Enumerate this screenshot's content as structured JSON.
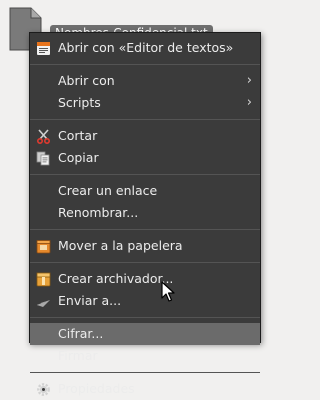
{
  "desktop": {
    "file_name": "Nombres-Confidencial.txt",
    "file_icon": "text-file-icon"
  },
  "menu": {
    "open_with_editor": "Abrir con «Editor de textos»",
    "open_with": "Abrir con",
    "scripts": "Scripts",
    "cut": "Cortar",
    "copy": "Copiar",
    "create_link": "Crear un enlace",
    "rename": "Renombrar...",
    "move_to_trash": "Mover a la papelera",
    "create_archive": "Crear archivador...",
    "send_to": "Enviar a...",
    "encrypt": "Cifrar...",
    "sign": "Firmar",
    "properties": "Propiedades",
    "submenu_arrow": "›"
  },
  "colors": {
    "menu_background": "#3b3b3b",
    "menu_highlight": "#6b6b6b",
    "menu_text": "#ececec",
    "desktop_background": "#f1f0ef",
    "file_label_background": "#6f6f6f"
  }
}
